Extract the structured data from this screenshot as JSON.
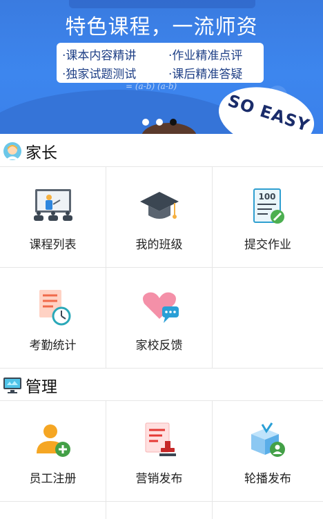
{
  "banner": {
    "headline": "特色课程，一流师资",
    "features": [
      "·课本内容精讲",
      "·作业精准点评",
      "·独家试题测试",
      "·课后精准答疑"
    ],
    "formula": "= (a-b) (a-b)",
    "sticker_text": "SO EASY",
    "carousel": {
      "slide_count": 3,
      "active_index": 2
    }
  },
  "sections": [
    {
      "title": "家长",
      "icon": "parent-avatar-icon",
      "items": [
        {
          "label": "课程列表",
          "icon": "classroom-teacher-icon"
        },
        {
          "label": "我的班级",
          "icon": "graduation-cap-icon"
        },
        {
          "label": "提交作业",
          "icon": "homework-score-icon"
        },
        {
          "label": "考勤统计",
          "icon": "attendance-clock-icon"
        },
        {
          "label": "家校反馈",
          "icon": "heart-chat-icon"
        },
        {
          "label": "",
          "icon": ""
        }
      ]
    },
    {
      "title": "管理",
      "icon": "monitor-icon",
      "items": [
        {
          "label": "员工注册",
          "icon": "add-user-icon"
        },
        {
          "label": "营销发布",
          "icon": "marketing-stamp-icon"
        },
        {
          "label": "轮播发布",
          "icon": "carousel-box-user-icon"
        }
      ]
    }
  ],
  "colors": {
    "banner_blue": "#3d86ee",
    "grid_border": "#e6e6e6"
  }
}
